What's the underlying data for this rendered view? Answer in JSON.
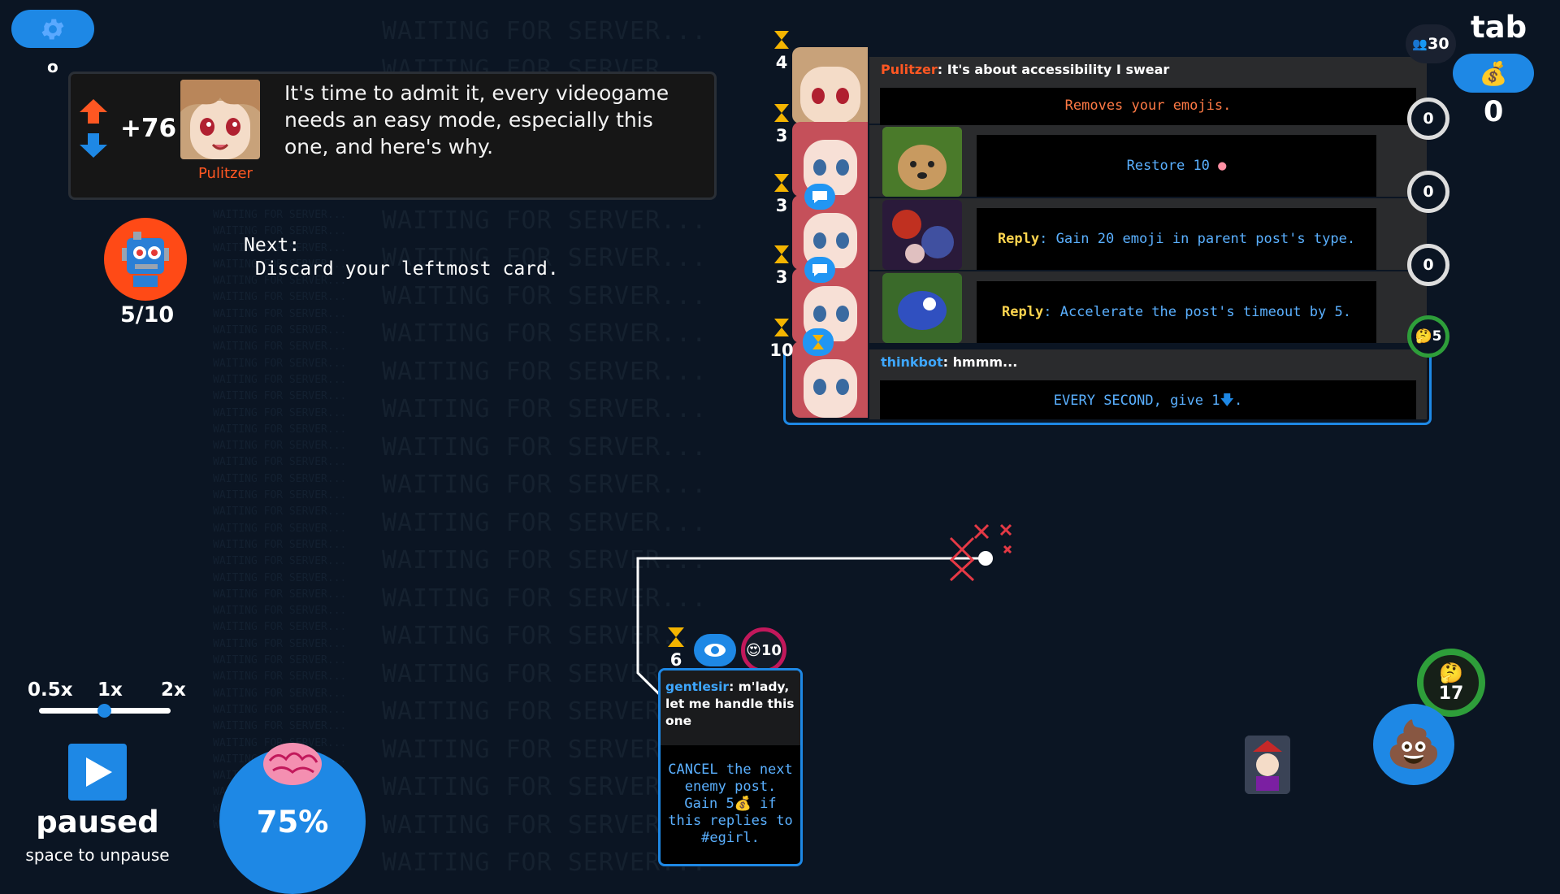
{
  "settings": {
    "key_hint": "o",
    "icon": "gear-icon"
  },
  "background": {
    "watermark_text": "WAITING FOR SERVER..."
  },
  "active_post": {
    "score": "+76",
    "text": "It's time to admit it, every videogame needs an easy mode, especially this one, and here's why.",
    "author": "Pulitzer"
  },
  "opponent": {
    "cards_count": "5/10",
    "next_label": "Next:",
    "next_action": " Discard your leftmost card."
  },
  "feed": {
    "viewer_count": "30",
    "posts": [
      {
        "timer": "4",
        "author": "Pulitzer",
        "title": ": It's about accessibility I swear",
        "effect": "Removes your emojis."
      },
      {
        "timer": "3",
        "effect": "Restore 10",
        "reply_count": "0"
      },
      {
        "timer": "3",
        "effect_label": "Reply",
        "effect": ": Gain 20 emoji in parent post's type.",
        "reply_count": "0"
      },
      {
        "timer": "3",
        "effect_label": "Reply",
        "effect": ": Accelerate the post's timeout by 5.",
        "reply_count": "0"
      },
      {
        "timer": "10",
        "author": "thinkbot",
        "title": ": hmmm...",
        "effect": "EVERY SECOND, give 1",
        "reply_count": "5"
      }
    ],
    "first_circle": "0"
  },
  "hud": {
    "tab_label": "tab",
    "money": "0"
  },
  "speed": {
    "options": [
      "0.5x",
      "1x",
      "2x"
    ],
    "selected": "1x",
    "status": "paused",
    "hint": "space to unpause"
  },
  "brain_meter": {
    "percent": "75%",
    "level": 0.75
  },
  "hand_card": {
    "timer": "6",
    "emoji_count": "10",
    "author": "gentlesir",
    "text": ": m'lady, let me handle this one",
    "effect_line1": "CANCEL the next",
    "effect_line2": "enemy post.",
    "effect_line3": "Gain 5",
    "effect_line3b": " if",
    "effect_line4": "this replies to",
    "effect_line5": "#egirl."
  },
  "bottom_right": {
    "think_count": "17"
  },
  "colors": {
    "accent": "#1e88e5",
    "author_red": "#ff5722",
    "author_blue": "#3ea7ff",
    "card_text_blue": "#5ab0ff",
    "warning": "#ff7a45"
  }
}
